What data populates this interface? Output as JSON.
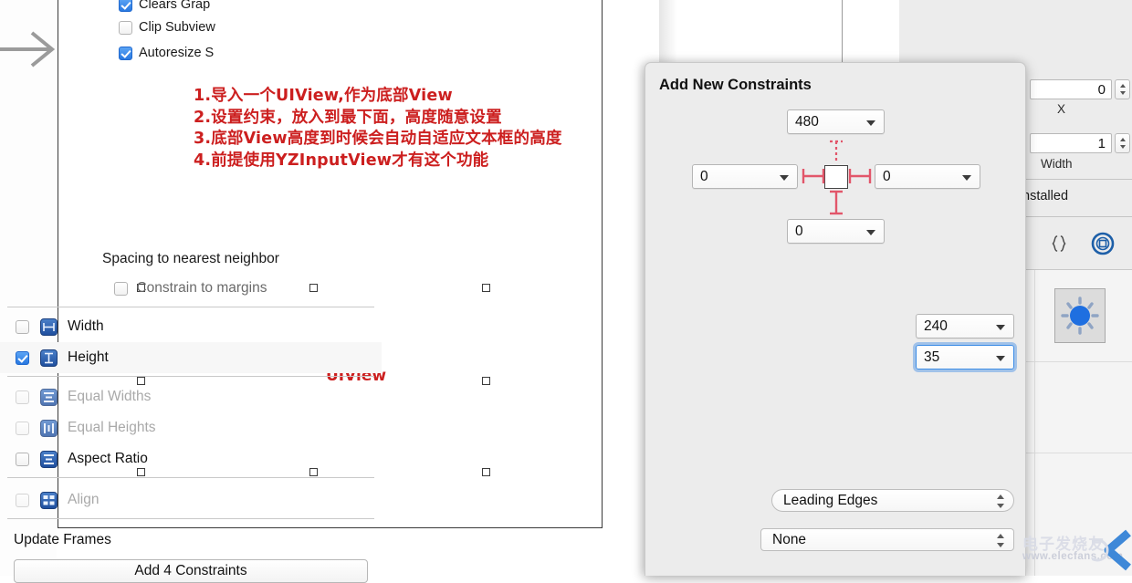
{
  "canvas": {
    "entry_arrow_icon": "arrow-right-icon",
    "annotation_lines": [
      "1.导入一个UIView,作为底部View",
      "2.设置约束，放入到最下面，高度随意设置",
      "3.底部View高度到时候会自动自适应文本框的高度",
      "4.前提使用YZInputView才有这个功能"
    ],
    "annotation_color": "#cc1f1f",
    "selected_view_label": "UIView",
    "handle_count": 8
  },
  "constraints_dialog": {
    "title": "Add New Constraints",
    "spacing": {
      "top_value": "480",
      "leading_value": "0",
      "trailing_value": "0",
      "bottom_value": "0",
      "top_strut_active": false,
      "leading_strut_active": true,
      "trailing_strut_active": true,
      "bottom_strut_active": true,
      "strut_color": "#e2566a"
    },
    "caption": "Spacing to nearest neighbor",
    "constrain_to_margins": {
      "label": "Constrain to margins",
      "checked": false,
      "enabled": false
    },
    "rows": [
      {
        "label": "Width",
        "icon": "width-constraint-icon",
        "checked": false,
        "enabled": true,
        "value": "240",
        "has_value": true,
        "focused": false
      },
      {
        "label": "Height",
        "icon": "height-constraint-icon",
        "checked": true,
        "enabled": true,
        "value": "35",
        "has_value": true,
        "focused": true
      },
      {
        "label": "Equal Widths",
        "icon": "equal-widths-icon",
        "checked": false,
        "enabled": false,
        "value": "",
        "has_value": false,
        "focused": false
      },
      {
        "label": "Equal Heights",
        "icon": "equal-heights-icon",
        "checked": false,
        "enabled": false,
        "value": "",
        "has_value": false,
        "focused": false
      },
      {
        "label": "Aspect Ratio",
        "icon": "aspect-ratio-icon",
        "checked": false,
        "enabled": true,
        "value": "",
        "has_value": false,
        "focused": false
      }
    ],
    "align": {
      "label": "Align",
      "icon": "align-icon",
      "checked": false,
      "enabled": false,
      "value": "Leading Edges"
    },
    "update_frames": {
      "label": "Update Frames",
      "value": "None"
    },
    "add_button_label": "Add 4 Constraints"
  },
  "inspector": {
    "checkboxes": [
      {
        "label": "Clears Grap",
        "checked": true
      },
      {
        "label": "Clip Subview",
        "checked": false
      },
      {
        "label": "Autoresize S",
        "checked": true
      }
    ],
    "fields": [
      {
        "value": "0",
        "sublabel": "X"
      },
      {
        "value": "1",
        "sublabel": "Width"
      }
    ],
    "installed": {
      "label": "Installed",
      "checked": true
    },
    "library_tabs": [
      {
        "icon": "code-snippets-icon",
        "selected": false
      },
      {
        "icon": "object-library-icon",
        "selected": true
      }
    ],
    "library_items": [
      {
        "icon": "comet-object-icon"
      },
      {
        "icon": "comet-pair-object-icon"
      },
      {
        "icon": "comet-small-object-icon"
      },
      {
        "icon": "activity-indicator-icon"
      }
    ]
  },
  "watermark": {
    "text": "电子发烧友",
    "url": "www.elecfans.com"
  }
}
